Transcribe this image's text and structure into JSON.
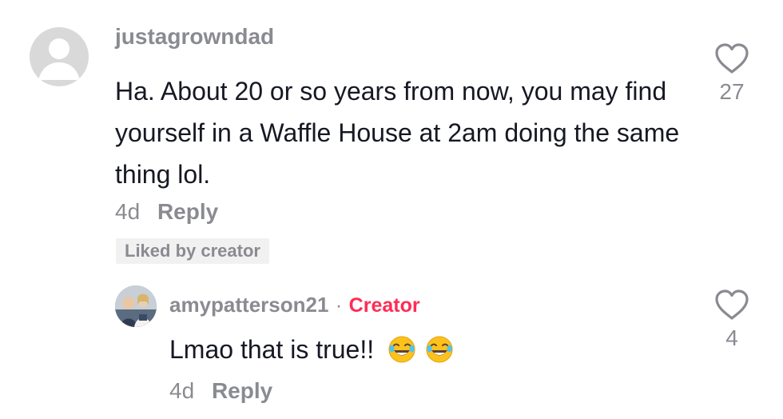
{
  "comment": {
    "username": "justagrowndad",
    "text": "Ha. About 20 or so years from now, you may find yourself in a Waffle House at 2am doing the same thing lol.",
    "time": "4d",
    "reply_label": "Reply",
    "likes": "27",
    "badge": "Liked by creator"
  },
  "reply": {
    "username": "amypatterson21",
    "separator": "·",
    "creator_label": "Creator",
    "text": "Lmao that is true!!",
    "emojis": [
      "face-with-tears-of-joy-icon",
      "face-with-tears-of-joy-icon"
    ],
    "time": "4d",
    "reply_label": "Reply",
    "likes": "4"
  },
  "colors": {
    "text": "#161823",
    "muted": "#8a8b91",
    "creator": "#fe2c55",
    "badge_bg": "#f1f1f2"
  }
}
